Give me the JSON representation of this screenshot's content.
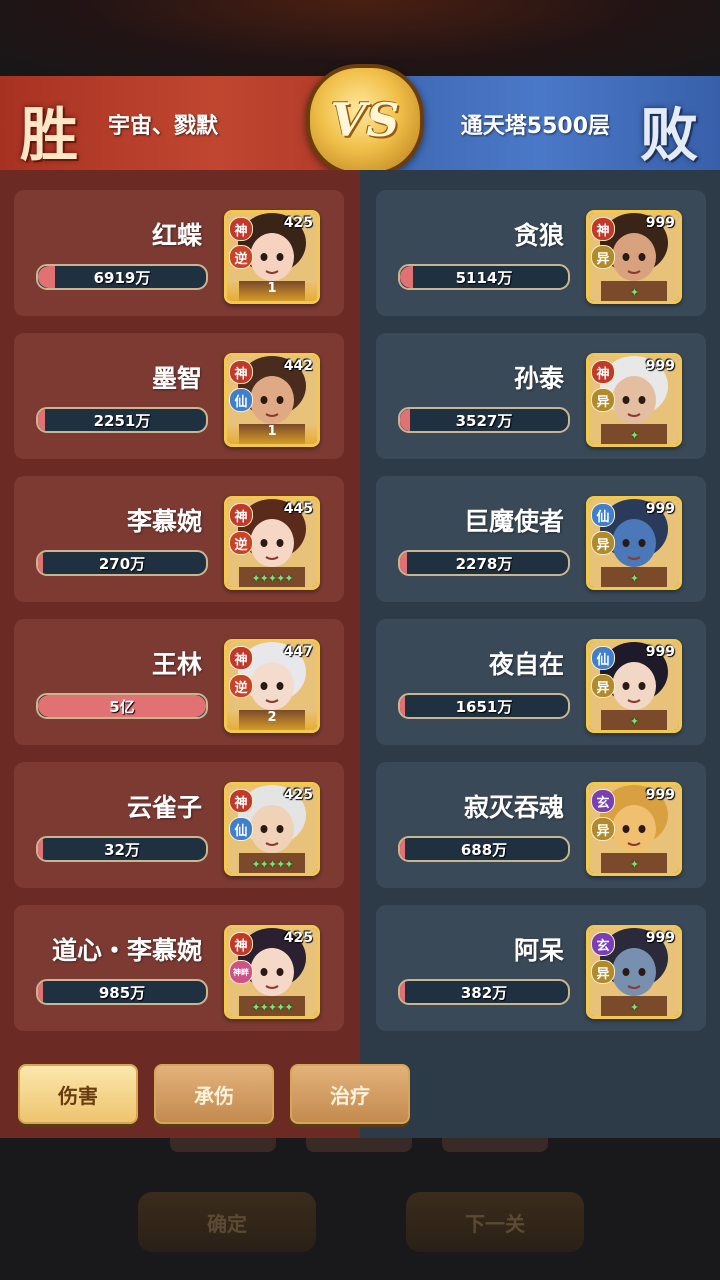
{
  "header": {
    "left_result": "胜",
    "left_team": "宇宙、戮默",
    "vs": "VS",
    "right_result": "败",
    "right_team": "通天塔5500层"
  },
  "colors": {
    "left_panel": "#6b2a24",
    "right_panel": "#2d3a47",
    "bar_fill": "#e27173",
    "badge_god": "#c0392b",
    "badge_immortal": "#3f7fd0",
    "badge_rebel": "#c8432a",
    "badge_xuan": "#7a3fb8",
    "badge_yi": "#b08a2c"
  },
  "left_heroes": [
    {
      "name": "红蝶",
      "value": "6919万",
      "level": "425",
      "badges": [
        "神",
        "逆"
      ],
      "bottom": "1",
      "fill": 0.1,
      "skin": "#f5d3c0",
      "hair": "#3a2418"
    },
    {
      "name": "墨智",
      "value": "2251万",
      "level": "442",
      "badges": [
        "神",
        "仙"
      ],
      "bottom": "1",
      "fill": 0.04,
      "skin": "#e0a986",
      "hair": "#4a2c1e"
    },
    {
      "name": "李慕婉",
      "value": "270万",
      "level": "445",
      "badges": [
        "神",
        "逆"
      ],
      "bottom": "✦✦✦✦✦",
      "fill": 0.0,
      "skin": "#f6d6c4",
      "hair": "#5a2a1a"
    },
    {
      "name": "王林",
      "value": "5亿",
      "level": "447",
      "badges": [
        "神",
        "逆"
      ],
      "bottom": "2",
      "fill": 1.0,
      "skin": "#f3dccd",
      "hair": "#e8e8ec"
    },
    {
      "name": "云雀子",
      "value": "32万",
      "level": "425",
      "badges": [
        "神",
        "仙"
      ],
      "bottom": "✦✦✦✦✦",
      "fill": 0.0,
      "skin": "#efd2b8",
      "hair": "#e4e4e4"
    },
    {
      "name": "道心・李慕婉",
      "value": "985万",
      "level": "425",
      "badges": [
        "神",
        "神畔"
      ],
      "bottom": "✦✦✦✦✦",
      "fill": 0.0,
      "skin": "#f5d8c8",
      "hair": "#2a2030"
    }
  ],
  "right_heroes": [
    {
      "name": "贪狼",
      "value": "5114万",
      "level": "999",
      "badges": [
        "神",
        "异"
      ],
      "bottom": "✦",
      "fill": 0.08,
      "skin": "#d9a27e",
      "hair": "#3a2418"
    },
    {
      "name": "孙泰",
      "value": "3527万",
      "level": "999",
      "badges": [
        "神",
        "异"
      ],
      "bottom": "✦",
      "fill": 0.06,
      "skin": "#e4bea0",
      "hair": "#e8e8e8"
    },
    {
      "name": "巨魔使者",
      "value": "2278万",
      "level": "999",
      "badges": [
        "仙",
        "异"
      ],
      "bottom": "✦",
      "fill": 0.04,
      "skin": "#4a78b8",
      "hair": "#2a3a5a"
    },
    {
      "name": "夜自在",
      "value": "1651万",
      "level": "999",
      "badges": [
        "仙",
        "异"
      ],
      "bottom": "✦",
      "fill": 0.03,
      "skin": "#f2d6c6",
      "hair": "#1e1a2a"
    },
    {
      "name": "寂灭吞魂",
      "value": "688万",
      "level": "999",
      "badges": [
        "玄",
        "异"
      ],
      "bottom": "✦",
      "fill": 0.0,
      "skin": "#f0c070",
      "hair": "#d8a040"
    },
    {
      "name": "阿呆",
      "value": "382万",
      "level": "999",
      "badges": [
        "玄",
        "异"
      ],
      "bottom": "✦",
      "fill": 0.0,
      "skin": "#7890b0",
      "hair": "#2a2a3a"
    }
  ],
  "tabs": [
    "伤害",
    "承伤",
    "治疗"
  ],
  "footer": {
    "confirm_label": "确定",
    "next_label": "下一关"
  }
}
